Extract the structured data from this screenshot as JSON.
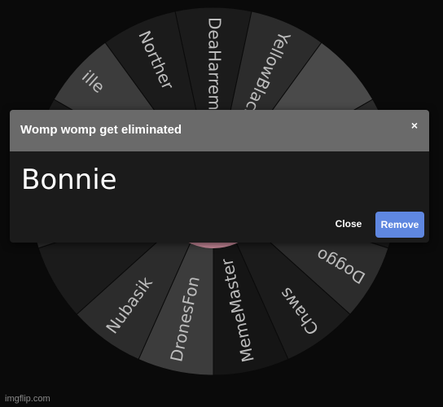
{
  "wheel": {
    "segments": [
      {
        "label": "DeaHarremi",
        "color": "#1b1b1b"
      },
      {
        "label": "YellowBlack",
        "color": "#2c2c2c"
      },
      {
        "label": "",
        "color": "#4a4a4a"
      },
      {
        "label": "",
        "color": "#2c2c2c"
      },
      {
        "label": "",
        "color": "#1b1b1b"
      },
      {
        "label": "Doggo",
        "color": "#2c2c2c"
      },
      {
        "label": "Chaws",
        "color": "#1b1b1b"
      },
      {
        "label": "MemeMaster",
        "color": "#151515"
      },
      {
        "label": "DronesFon",
        "color": "#3c3c3c"
      },
      {
        "label": "Nubasik",
        "color": "#2c2c2c"
      },
      {
        "label": "",
        "color": "#1b1b1b"
      },
      {
        "label": "",
        "color": "#2c2c2c"
      },
      {
        "label": "",
        "color": "#1b1b1b"
      },
      {
        "label": "ille",
        "color": "#3c3c3c"
      },
      {
        "label": "Norther",
        "color": "#1b1b1b"
      }
    ],
    "center_color": "#c98a9a"
  },
  "dialog": {
    "title": "Womp womp get eliminated",
    "close_icon": "×",
    "winner": "Bonnie",
    "close_label": "Close",
    "remove_label": "Remove",
    "accent_color": "#5f87e0"
  },
  "watermark": "imgflip.com"
}
